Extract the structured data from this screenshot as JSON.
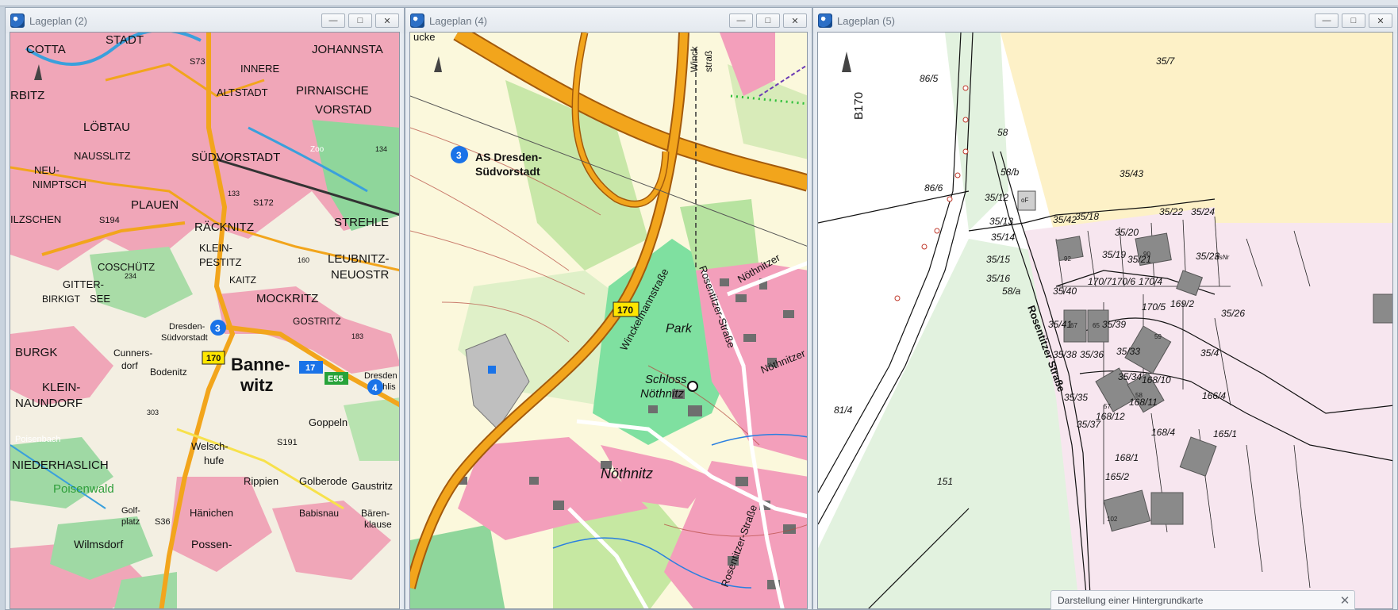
{
  "windows": [
    {
      "title": "Lageplan (2)"
    },
    {
      "title": "Lageplan (4)"
    },
    {
      "title": "Lageplan (5)"
    }
  ],
  "window_buttons": {
    "minimize": "—",
    "maximize": "□",
    "close": "✕"
  },
  "map1": {
    "places": [
      "COTTA",
      "STADT",
      "JOHANNSTA",
      "INNERE",
      "ALTSTADT",
      "PIRNAISCHE",
      "VORSTAD",
      "RBITZ",
      "LÖBTAU",
      "NAUSSLITZ",
      "SÜDVORSTADT",
      "NEU-",
      "NIMPTSCH",
      "PLAUEN",
      "ILZSCHEN",
      "RÄCKNITZ",
      "STREHLE",
      "KLEIN-",
      "PESTITZ",
      "LEUBNITZ-",
      "NEUOSTR",
      "COSCHÜTZ",
      "GITTER-",
      "SEE",
      "BIRKIGT",
      "KAITZ",
      "MOCKRITZ",
      "GOSTRITZ",
      "BURGK",
      "Dresden-",
      "Südvorstadt",
      "Cunners-",
      "dorf",
      "KLEIN-",
      "NAUNDORF",
      "Bodenitz",
      "Banne-",
      "witz",
      "Dresden",
      "Prohlis",
      "NIEDERHASLICH",
      "Poisenwald",
      "Welsch-",
      "hufe",
      "Goppeln",
      "Rippien",
      "Golberode",
      "Gaustritz",
      "Hänichen",
      "Babisnau",
      "Bären-",
      "klause",
      "Golf-",
      "platz",
      "Wilmsdorf",
      "Possen-",
      "Zoo",
      "Poisenbach"
    ],
    "roads": [
      "S73",
      "S194",
      "S172",
      "S191",
      "S36",
      "170",
      "17",
      "E55",
      "134",
      "133",
      "234",
      "183",
      "303",
      "160"
    ],
    "markers": [
      "3",
      "4"
    ]
  },
  "map2": {
    "labels": [
      "ucke",
      "Winckelmannstraße",
      "Rosentitzer-Straße",
      "Nöthnitzer",
      "Park",
      "Schloss",
      "Nöthnitz",
      "Nöthnitz",
      "Rosentitzer-Straße",
      "Nöthnitzer",
      "Winck",
      "straß",
      "AS Dresden-",
      "Südvorstadt"
    ],
    "road": "170",
    "marker": "3"
  },
  "map3": {
    "road": "B170",
    "street": "Rosentitzer Straße",
    "parcels": [
      "86/5",
      "86/6",
      "58",
      "58/b",
      "35/7",
      "35/43",
      "35/12",
      "35/13",
      "35/14",
      "35/15",
      "35/16",
      "35/42",
      "35/18",
      "35/22",
      "35/24",
      "35/20",
      "35/19",
      "35/21",
      "35/23",
      "35/40",
      "35/41",
      "35/39",
      "35/38",
      "35/36",
      "35/33",
      "35/34",
      "35/35",
      "35/37",
      "35/4",
      "35/26",
      "170/7",
      "170/6",
      "170/4",
      "170/5",
      "169/2",
      "168/10",
      "168/11",
      "168/12",
      "168/4",
      "168/1",
      "166/4",
      "165/2",
      "165/1",
      "81/4",
      "151",
      "58/a",
      "HsNr"
    ],
    "houses": [
      "oF",
      "92",
      "90",
      "67",
      "65",
      "57",
      "58",
      "59",
      "102"
    ]
  },
  "notification": {
    "text": "Darstellung einer Hintergrundkarte",
    "close": "✕"
  },
  "colors": {
    "urban": "#f0a6b8",
    "forest": "#9fd9a4",
    "road": "#f2a51c",
    "water": "#3aa0dc",
    "marker": "#1a73e8",
    "yellowRoad": "#ffe600",
    "parcelPink": "#f7e6ef",
    "parcelYellow": "#fdf1c7",
    "parcelGreen": "#e2f2df"
  }
}
